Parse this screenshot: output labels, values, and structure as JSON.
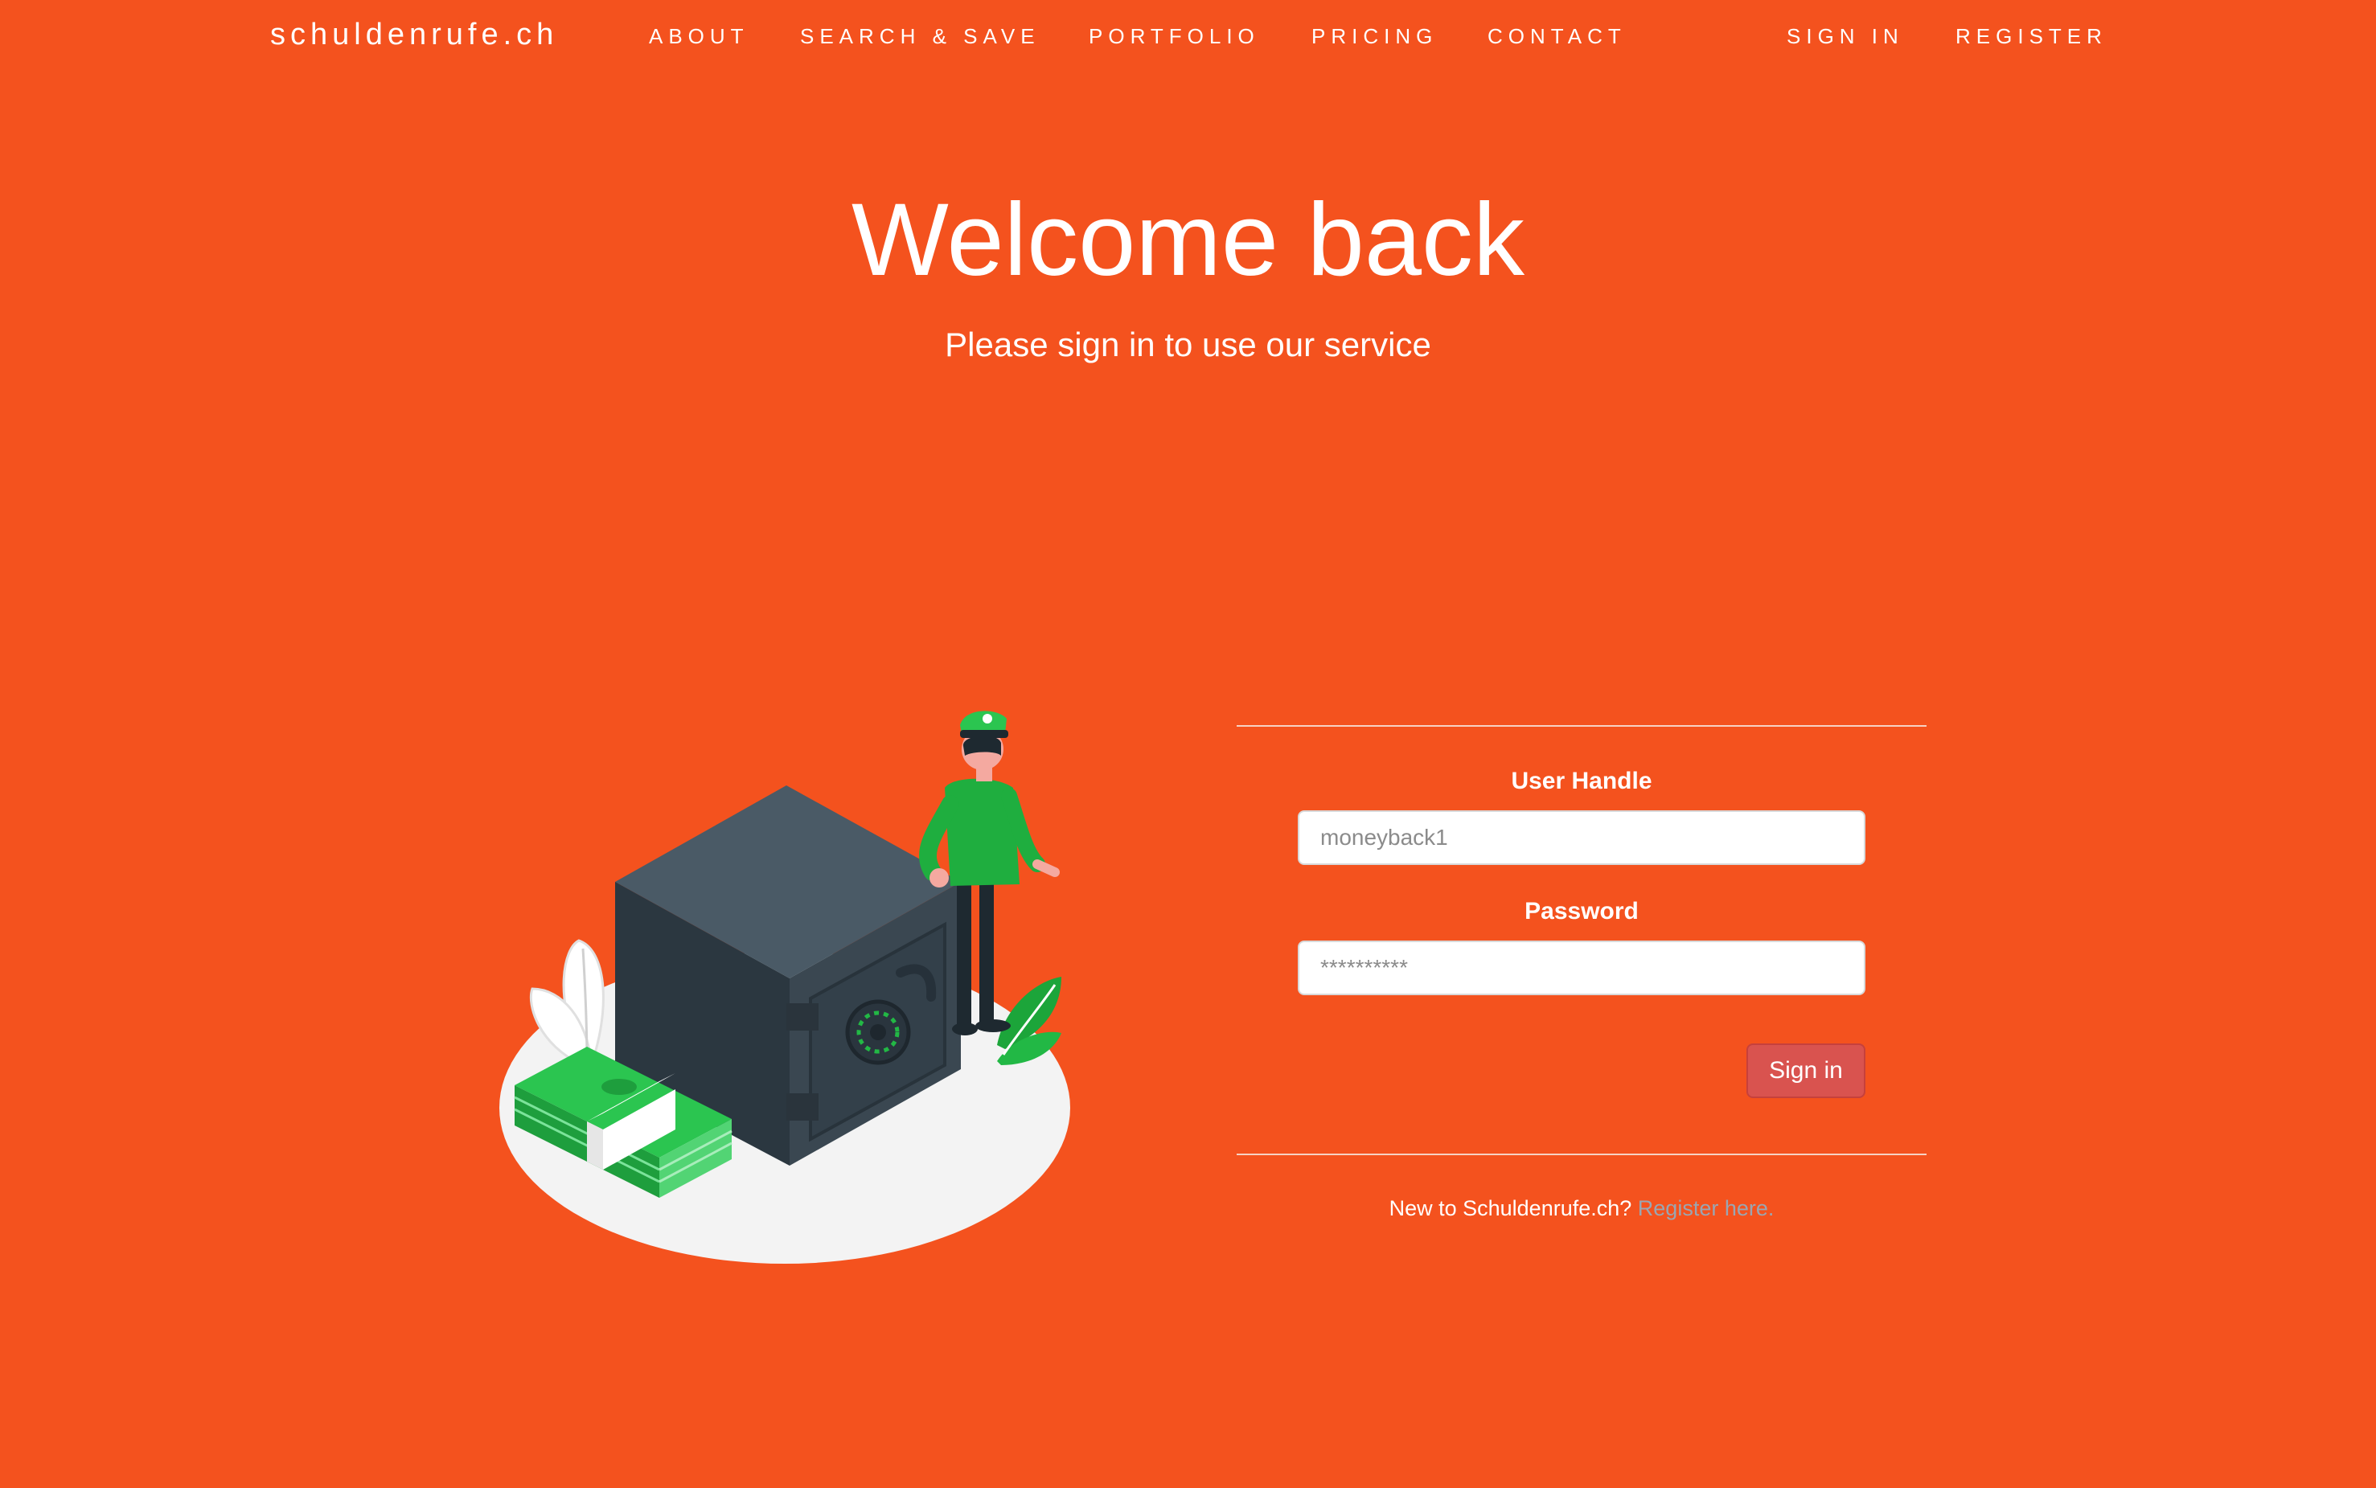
{
  "nav": {
    "brand": "schuldenrufe.ch",
    "links": [
      "ABOUT",
      "SEARCH & SAVE",
      "PORTFOLIO",
      "PRICING",
      "CONTACT"
    ],
    "auth": [
      "SIGN IN",
      "REGISTER"
    ]
  },
  "hero": {
    "title": "Welcome back",
    "subtitle": "Please sign in to use our service"
  },
  "form": {
    "username_label": "User Handle",
    "username_placeholder": "moneyback1",
    "password_label": "Password",
    "password_placeholder": "**********",
    "submit_label": "Sign in",
    "register_prompt": "New to Schuldenrufe.ch?",
    "register_link": "Register here."
  },
  "colors": {
    "background": "#F4521E",
    "button": "#D9534F",
    "link": "#9AA6B2"
  }
}
